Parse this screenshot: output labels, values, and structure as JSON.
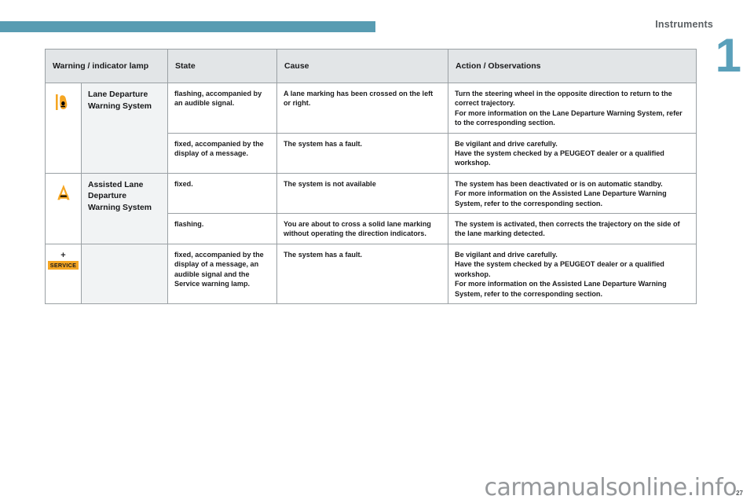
{
  "header": {
    "section_title": "Instruments",
    "chapter_number": "1",
    "accent_color": "#589cb2"
  },
  "table": {
    "columns": [
      {
        "key": "lamp",
        "label": "Warning / indicator lamp"
      },
      {
        "key": "state",
        "label": "State"
      },
      {
        "key": "cause",
        "label": "Cause"
      },
      {
        "key": "action",
        "label": "Action / Observations"
      }
    ],
    "groups": [
      {
        "icon": "lane-departure-warning-icon",
        "icon_color": "#f5a623",
        "name": "Lane Departure\nWarning System",
        "name_line1": "Lane Departure",
        "name_line2": "Warning System",
        "rows": [
          {
            "state": "flashing, accompanied by an audible signal.",
            "cause": "A lane marking has been crossed on the left or right.",
            "action_line1": "Turn the steering wheel in the opposite direction to return to the correct trajectory.",
            "action_line2": "For more information on the Lane Departure Warning System, refer to the corresponding section."
          },
          {
            "state": "fixed, accompanied by the display of a message.",
            "cause": "The system has a fault.",
            "action_line1": "Be vigilant and drive carefully.",
            "action_line2": "Have the system checked by a PEUGEOT dealer or a qualified workshop."
          }
        ]
      },
      {
        "icon": "assisted-lane-departure-warning-icon",
        "icon_color": "#f5a623",
        "name_line1": "Assisted Lane",
        "name_line2": "Departure",
        "name_line3": "Warning System",
        "rows": [
          {
            "state": "fixed.",
            "cause": "The system is not available",
            "action_line1": "The system has been deactivated or is on automatic standby.",
            "action_line2": "For more information on the Assisted Lane Departure Warning System, refer to the corresponding section."
          },
          {
            "state": "flashing.",
            "cause": "You are about to cross a solid lane marking without operating the direction indicators.",
            "action_line1": "The system is activated, then corrects the trajectory on the side of the lane marking detected.",
            "action_line2": ""
          }
        ]
      },
      {
        "icon": "service-warning-icon",
        "icon_plus": "+",
        "icon_badge": "SERVICE",
        "icon_color": "#f5a623",
        "rows": [
          {
            "state": "fixed, accompanied by the display of a message, an audible signal and the Service warning lamp.",
            "cause": "The system has a fault.",
            "action_line1": "Be vigilant and drive carefully.",
            "action_line2": "Have the system checked by a PEUGEOT dealer or a qualified workshop.",
            "action_line3": "For more information on the Assisted Lane Departure Warning System, refer to the corresponding section."
          }
        ]
      }
    ]
  },
  "footer": {
    "page_number": "27",
    "watermark": "carmanualsonline.info"
  }
}
